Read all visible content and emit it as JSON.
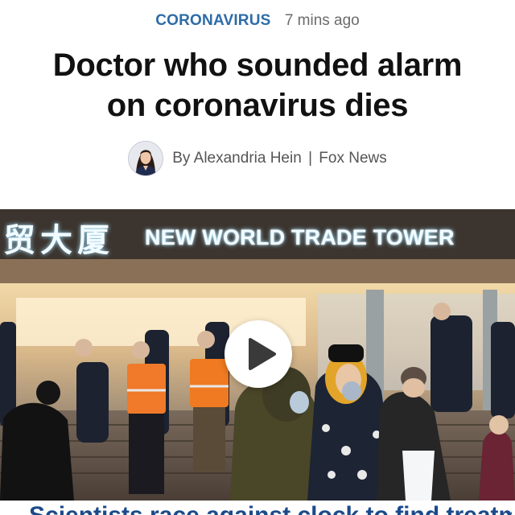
{
  "article": {
    "category": "CORONAVIRUS",
    "time_ago": "7 mins ago",
    "headline_line1": "Doctor who sounded alarm",
    "headline_line2": "on coronavirus dies",
    "byline_prefix": "By",
    "author": "Alexandria Hein",
    "separator": "|",
    "outlet": "Fox News"
  },
  "video": {
    "sign_cjk": "贸大厦",
    "sign_text": "NEW WORLD TRADE TOWER",
    "play_icon": "play-icon"
  },
  "next_headline": "Scientists race against clock to find treatment",
  "colors": {
    "category": "#2d6ca8",
    "headline": "#111111",
    "byline": "#555555",
    "next_headline": "#1b4a8a"
  }
}
